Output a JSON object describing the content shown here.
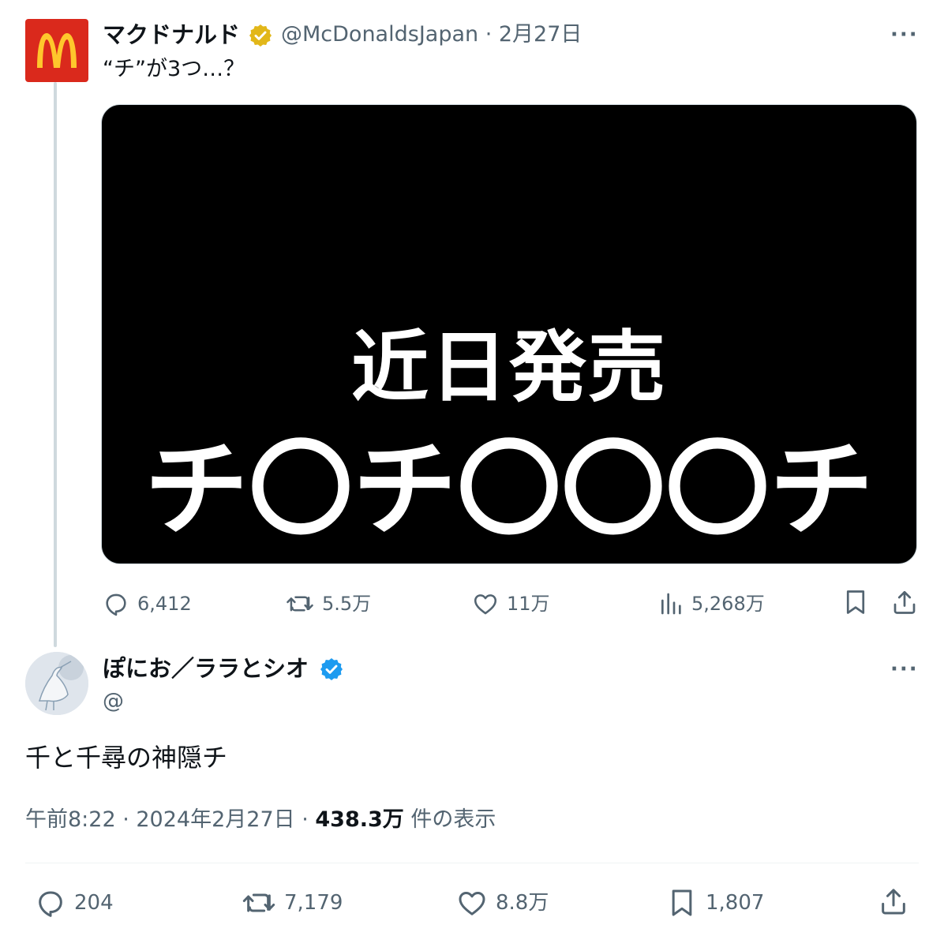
{
  "quoted_tweet": {
    "author_name": "マクドナルド",
    "handle": "@McDonaldsJapan",
    "separator": " · ",
    "date": "2月27日",
    "more": "···",
    "text": "“チ”が3つ…？",
    "media": {
      "line1": "近日発売",
      "line2": "チ〇チ〇〇〇チ"
    },
    "actions": {
      "replies": "6,412",
      "retweets": "5.5万",
      "likes": "11万",
      "views": "5,268万"
    }
  },
  "main_tweet": {
    "author_name": "ぽにお／ララとシオ",
    "handle": "@",
    "more": "···",
    "text": "千と千尋の神隠チ",
    "time": "午前8:22 · 2024年2月27日 · ",
    "views_count": "438.3万",
    "views_label": " 件の表示",
    "actions": {
      "replies": "204",
      "retweets": "7,179",
      "likes": "8.8万",
      "bookmarks": "1,807"
    }
  },
  "colors": {
    "verified_gold": "#e2b719",
    "verified_blue": "#1d9bf0",
    "mcdonalds_red": "#da291c",
    "mcdonalds_yellow": "#ffc72c",
    "secondary_text": "#536471"
  }
}
